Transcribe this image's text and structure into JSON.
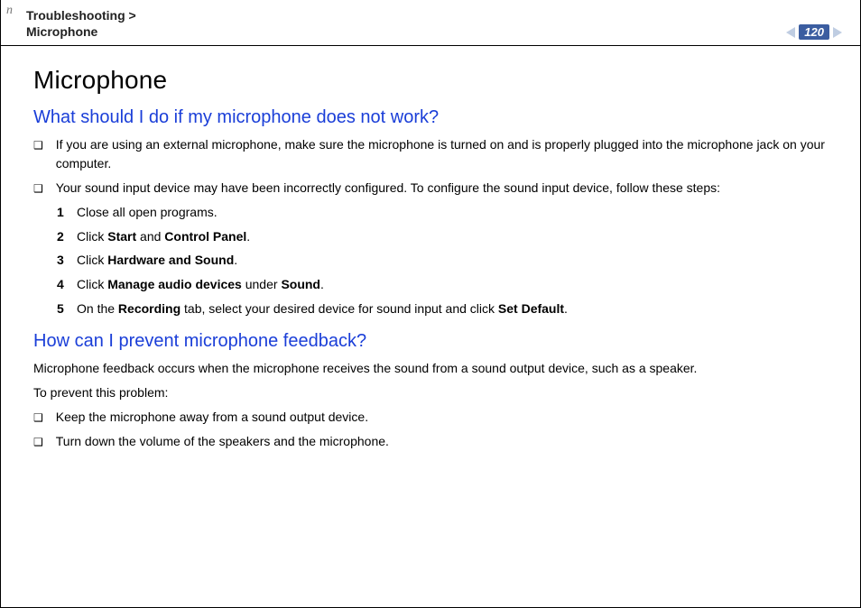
{
  "cornerLetter": "n",
  "header": {
    "breadcrumb_section": "Troubleshooting",
    "breadcrumb_sep": " > ",
    "breadcrumb_topic": "Microphone",
    "page_number": "120"
  },
  "title": "Microphone",
  "section1": {
    "heading": "What should I do if my microphone does not work?",
    "bullets": [
      "If you are using an external microphone, make sure the microphone is turned on and is properly plugged into the microphone jack on your computer.",
      "Your sound input device may have been incorrectly configured. To configure the sound input device, follow these steps:"
    ],
    "steps": [
      {
        "n": "1",
        "pre": "Close all open programs."
      },
      {
        "n": "2",
        "pre": "Click ",
        "b1": "Start",
        "mid": " and ",
        "b2": "Control Panel",
        "post": "."
      },
      {
        "n": "3",
        "pre": "Click ",
        "b1": "Hardware and Sound",
        "post": "."
      },
      {
        "n": "4",
        "pre": "Click ",
        "b1": "Manage audio devices",
        "mid": " under ",
        "b2": "Sound",
        "post": "."
      },
      {
        "n": "5",
        "pre": "On the ",
        "b1": "Recording",
        "mid": " tab, select your desired device for sound input and click ",
        "b2": "Set Default",
        "post": "."
      }
    ]
  },
  "section2": {
    "heading": "How can I prevent microphone feedback?",
    "intro1": "Microphone feedback occurs when the microphone receives the sound from a sound output device, such as a speaker.",
    "intro2": "To prevent this problem:",
    "bullets": [
      "Keep the microphone away from a sound output device.",
      "Turn down the volume of the speakers and the microphone."
    ]
  }
}
